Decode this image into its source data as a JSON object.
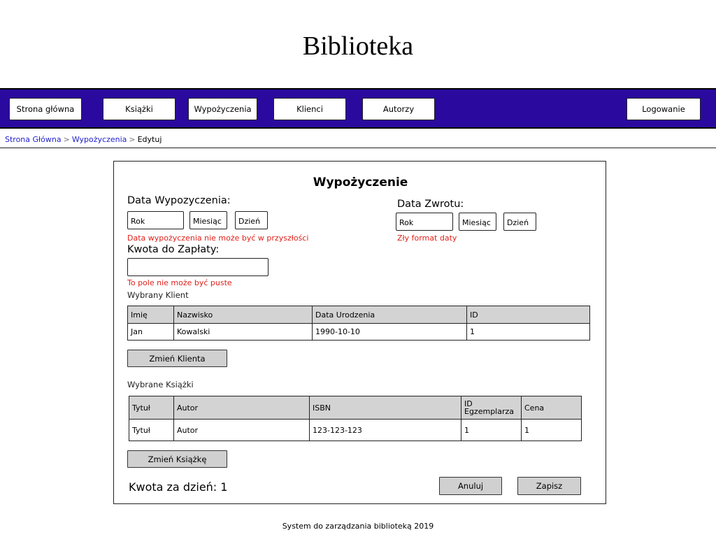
{
  "header": {
    "title": "Biblioteka"
  },
  "nav": {
    "home": "Strona główna",
    "books": "Książki",
    "loans": "Wypożyczenia",
    "clients": "Klienci",
    "authors": "Autorzy",
    "login": "Logowanie",
    "color": "#2a0a9e"
  },
  "breadcrumb": {
    "home": "Strona Główna",
    "loans": "Wypożyczenia",
    "current": "Edytuj",
    "separator": ">"
  },
  "form": {
    "title": "Wypożyczenie",
    "loan_date": {
      "label": "Data Wypozyczenia:",
      "year": "Rok",
      "month": "Miesiąc",
      "day": "Dzień",
      "error": "Data wypożyczenia nie może być w przyszłości"
    },
    "return_date": {
      "label": "Data Zwrotu:",
      "year": "Rok",
      "month": "Miesiąc",
      "day": "Dzień",
      "error": "Zły format daty"
    },
    "amount": {
      "label": "Kwota do Zapłaty:",
      "value": "",
      "error": "To pole nie może być puste"
    },
    "client": {
      "label": "Wybrany Klient",
      "headers": [
        "Imię",
        "Nazwisko",
        "Data Urodzenia",
        "ID"
      ],
      "rows": [
        [
          "Jan",
          "Kowalski",
          "1990-10-10",
          "1"
        ]
      ],
      "change_button": "Zmień Klienta"
    },
    "books": {
      "label": "Wybrane Książki",
      "headers": [
        "Tytuł",
        "Autor",
        "ISBN",
        "ID Egzemplarza",
        "Cena"
      ],
      "rows": [
        [
          "Tytuł",
          "Autor",
          "123-123-123",
          "1",
          "1"
        ]
      ],
      "change_button": "Zmień Książkę"
    },
    "daily_rate": "Kwota za dzień: 1",
    "cancel_button": "Anuluj",
    "save_button": "Zapisz",
    "error_color": "#e0201a"
  },
  "footer": {
    "text": "System do zarządzania biblioteką 2019"
  }
}
